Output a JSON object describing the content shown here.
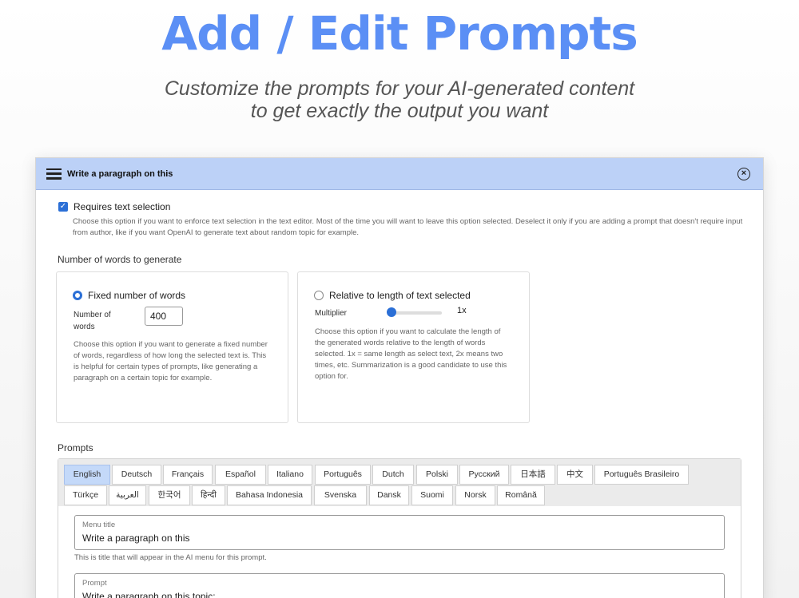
{
  "hero": {
    "title": "Add / Edit Prompts",
    "subtitle_line1": "Customize the prompts for your AI-generated content",
    "subtitle_line2": "to get exactly the output you want"
  },
  "dialog": {
    "title": "Write a paragraph on this",
    "menu_icon": "hamburger-menu-icon",
    "close_icon": "close-circle-icon",
    "requires_selection": {
      "label": "Requires text selection",
      "checked": true,
      "help": "Choose this option if you want to enforce text selection in the text editor. Most of the time you will want to leave this option selected. Deselect it only if you are adding a prompt that doesn't require input from author, like if you want OpenAI to generate text about random topic for example."
    },
    "words_section_label": "Number of words to generate",
    "fixed": {
      "label": "Fixed number of words",
      "selected": true,
      "number_label": "Number of words",
      "number_value": "400",
      "help": "Choose this option if you want to generate a fixed number of words, regardless of how long the selected text is. This is helpful for certain types of prompts, like generating a paragraph on a certain topic for example."
    },
    "relative": {
      "label": "Relative to length of text selected",
      "selected": false,
      "multiplier_label": "Multiplier",
      "multiplier_value": "1x",
      "slider_fraction": 0.0,
      "help": "Choose this option if you want to calculate the length of the generated words relative to the length of words selected. 1x = same length as select text, 2x means two times, etc. Summarization is a good candidate to use this option for."
    },
    "prompts_label": "Prompts",
    "tabs_row1": [
      "English",
      "Deutsch",
      "Français",
      "Español",
      "Italiano",
      "Português",
      "Dutch",
      "Polski",
      "Русский",
      "日本語",
      "中文",
      "Português Brasileiro"
    ],
    "tabs_row2": [
      "Türkçe",
      "العربية",
      "한국어",
      "हिन्दी",
      "Bahasa Indonesia",
      "Svenska",
      "Dansk",
      "Suomi",
      "Norsk",
      "Română"
    ],
    "active_tab": "English",
    "menu_title": {
      "label": "Menu title",
      "value": "Write a paragraph on this",
      "help": "This is title that will appear in the AI menu for this prompt."
    },
    "prompt": {
      "label": "Prompt",
      "value": "Write a paragraph on this topic:"
    },
    "colors": {
      "accent": "#2b6fd6",
      "header_bg": "#bcd1f7",
      "hero_title": "#5b8ff5",
      "active_tab": "#c4d9f9"
    }
  }
}
